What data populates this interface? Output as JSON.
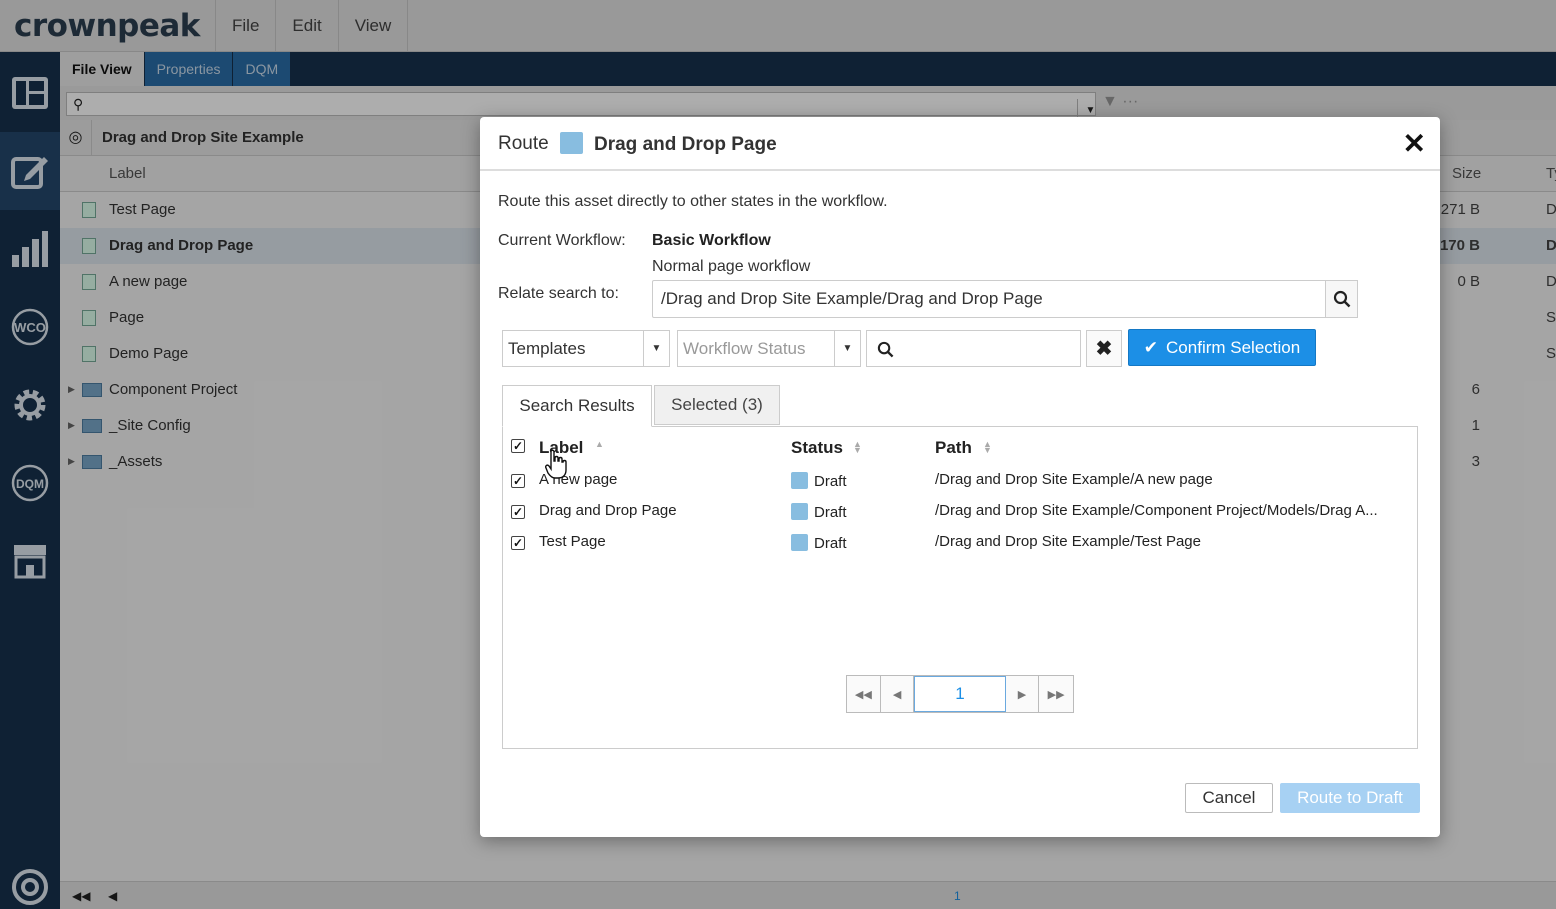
{
  "app": {
    "logo": "crownpeak",
    "menu": [
      "File",
      "Edit",
      "View"
    ]
  },
  "rail": {
    "icons": [
      "dashboard-icon",
      "edit-icon",
      "analytics-icon",
      "wco-icon",
      "settings-icon",
      "dqm-icon",
      "marketplace-icon",
      "help-icon"
    ],
    "wco_label": "WCO",
    "dqm_label": "DQM"
  },
  "main": {
    "tabs": [
      "File View",
      "Properties",
      "DQM"
    ],
    "breadcrumb": "Drag and Drop Site Example",
    "columns": {
      "label": "Label",
      "size": "Size",
      "t": "Ty"
    },
    "rows": [
      {
        "label": "Test Page",
        "size": "271 B",
        "t": "D",
        "type": "page"
      },
      {
        "label": "Drag and Drop Page",
        "size": "170 B",
        "t": "D",
        "type": "page"
      },
      {
        "label": "A new page",
        "size": "0 B",
        "t": "D",
        "type": "page"
      },
      {
        "label": "Page",
        "size": "",
        "t": "S",
        "type": "page"
      },
      {
        "label": "Demo Page",
        "size": "",
        "t": "S",
        "type": "page"
      },
      {
        "label": "Component Project",
        "size": "6",
        "t": "",
        "type": "folder"
      },
      {
        "label": "_Site Config",
        "size": "1",
        "t": "",
        "type": "folder"
      },
      {
        "label": "_Assets",
        "size": "3",
        "t": "",
        "type": "folder"
      }
    ],
    "pager_page": "1"
  },
  "modal": {
    "title_prefix": "Route",
    "asset_name": "Drag and Drop Page",
    "intro": "Route this asset directly to other states in the workflow.",
    "current_workflow_label": "Current Workflow:",
    "current_workflow_value": "Basic Workflow",
    "current_workflow_desc": "Normal page workflow",
    "relate_label": "Relate search to:",
    "relate_value": "/Drag and Drop Site Example/Drag and Drop Page",
    "filter_type": "Templates",
    "workflow_status_placeholder": "Workflow Status",
    "confirm_label": "Confirm Selection",
    "tab_results": "Search Results",
    "tab_selected": "Selected (3)",
    "grid_headers": {
      "label": "Label",
      "status": "Status",
      "path": "Path"
    },
    "grid_rows": [
      {
        "label": "A new page",
        "status": "Draft",
        "path": "/Drag and Drop Site Example/A new page",
        "checked": true
      },
      {
        "label": "Drag and Drop Page",
        "status": "Draft",
        "path": "/Drag and Drop Site Example/Component Project/Models/Drag A...",
        "checked": true
      },
      {
        "label": "Test Page",
        "status": "Draft",
        "path": "/Drag and Drop Site Example/Test Page",
        "checked": true
      }
    ],
    "page": "1",
    "cancel_label": "Cancel",
    "route_label": "Route to Draft",
    "colors": {
      "accent": "#1c8fe6",
      "draft": "#88bde0",
      "nav": "#17324d"
    }
  }
}
